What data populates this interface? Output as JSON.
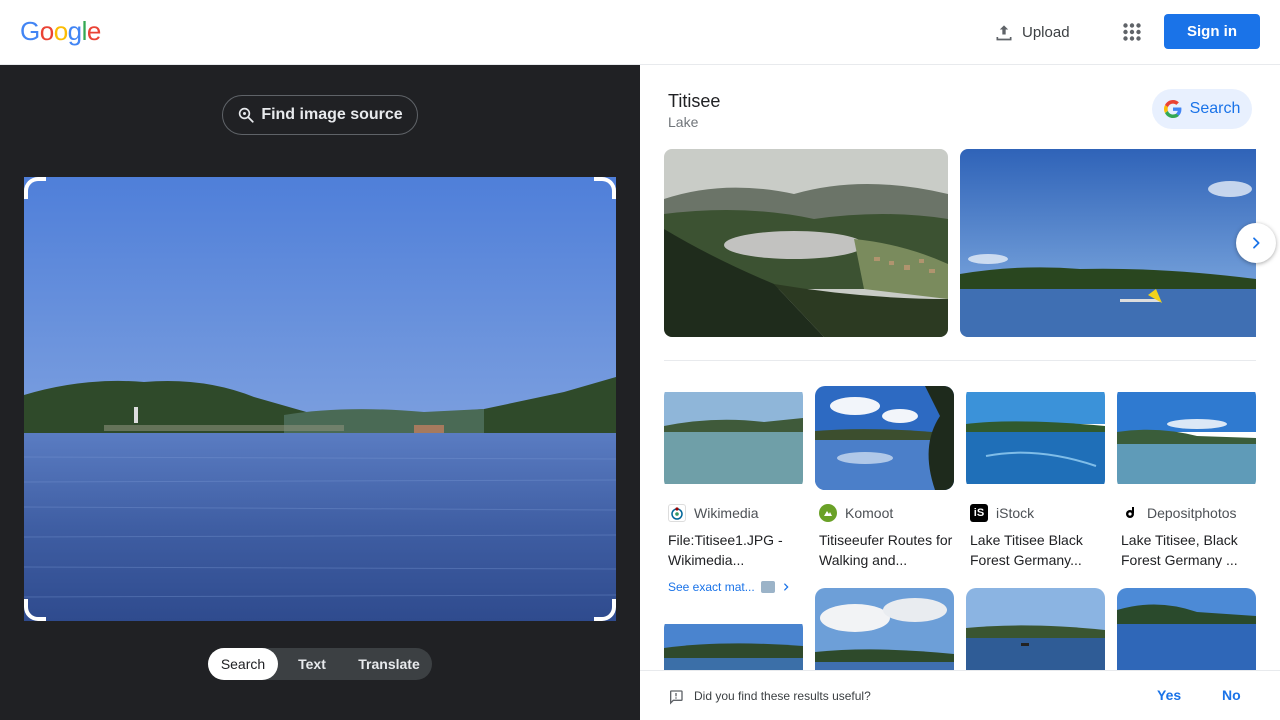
{
  "header": {
    "logo_letters": [
      {
        "char": "G",
        "color": "#4285F4"
      },
      {
        "char": "o",
        "color": "#EA4335"
      },
      {
        "char": "o",
        "color": "#FBBC05"
      },
      {
        "char": "g",
        "color": "#4285F4"
      },
      {
        "char": "l",
        "color": "#34A853"
      },
      {
        "char": "e",
        "color": "#EA4335"
      }
    ],
    "upload_label": "Upload",
    "upload_icon": "upload-icon",
    "apps_icon": "apps-grid-icon",
    "signin_label": "Sign in"
  },
  "lens": {
    "find_source_label": "Find image source",
    "find_source_icon": "lens-search-icon",
    "modes": [
      "Search",
      "Text",
      "Translate"
    ],
    "active_mode": "Search"
  },
  "entity": {
    "title": "Titisee",
    "subtitle": "Lake",
    "search_label": "Search"
  },
  "results": [
    {
      "source": "Wikimedia",
      "title": "File:Titisee1.JPG - Wikimedia...",
      "icon_color": "#ffffff",
      "see_exact": "See exact mat..."
    },
    {
      "source": "Komoot",
      "title": "Titiseeufer Routes for Walking and...",
      "icon_color": "#6aa127"
    },
    {
      "source": "iStock",
      "title": "Lake Titisee Black Forest Germany...",
      "icon_color": "#000000"
    },
    {
      "source": "Depositphotos",
      "title": "Lake Titisee, Black Forest Germany ...",
      "icon_color": "#ffffff"
    }
  ],
  "feedback": {
    "question": "Did you find these results useful?",
    "yes": "Yes",
    "no": "No"
  },
  "colors": {
    "accent": "#1a73e8",
    "left_bg": "#202124"
  }
}
